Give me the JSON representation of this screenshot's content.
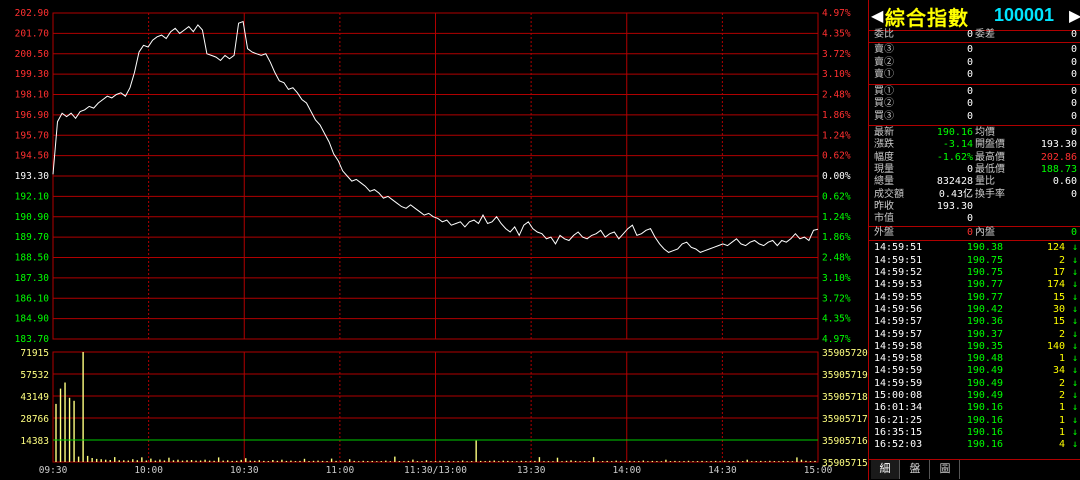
{
  "colors": {
    "up": "#ff3030",
    "down": "#00ff00",
    "neutral": "#ffffff",
    "grid": "#b00000",
    "volume": "#ffff80",
    "ref": "#00cc00"
  },
  "header": {
    "left_arrow": "◀",
    "name": "綜合指數",
    "code": "100001",
    "right_arrow": "▶"
  },
  "chart_data": [
    {
      "type": "line",
      "title": "",
      "ylim": [
        183.7,
        202.9
      ],
      "reference": 193.3,
      "x_ticks": [
        "09:30",
        "10:00",
        "10:30",
        "11:00",
        "11:30/13:00",
        "13:30",
        "14:00",
        "14:30",
        "15:00"
      ],
      "y_ticks_left": [
        "202.90",
        "201.70",
        "200.50",
        "199.30",
        "198.10",
        "196.90",
        "195.70",
        "194.50",
        "193.30",
        "192.10",
        "190.90",
        "189.70",
        "188.50",
        "187.30",
        "186.10",
        "184.90",
        "183.70"
      ],
      "y_ticks_right": [
        "4.97%",
        "4.35%",
        "3.72%",
        "3.10%",
        "2.48%",
        "1.86%",
        "1.24%",
        "0.62%",
        "0.00%",
        "0.62%",
        "1.24%",
        "1.86%",
        "2.48%",
        "3.10%",
        "3.72%",
        "4.35%",
        "4.97%"
      ],
      "series": [
        {
          "values": [
            193.4,
            196.5,
            197.0,
            196.8,
            197.0,
            196.7,
            197.1,
            197.2,
            197.4,
            197.3,
            197.6,
            197.8,
            198.0,
            197.9,
            198.1,
            198.2,
            198.0,
            198.5,
            199.4,
            200.6,
            201.0,
            200.9,
            201.3,
            201.5,
            201.6,
            201.4,
            201.8,
            202.0,
            201.7,
            201.9,
            202.1,
            201.8,
            202.2,
            201.9,
            200.5,
            200.4,
            200.3,
            200.1,
            200.4,
            200.2,
            200.4,
            202.3,
            202.4,
            200.8,
            200.6,
            200.5,
            200.4,
            200.5,
            200.0,
            199.4,
            198.9,
            198.8,
            198.4,
            198.5,
            198.2,
            197.8,
            197.6,
            197.1,
            196.6,
            196.3,
            195.8,
            195.3,
            194.6,
            194.2,
            193.6,
            193.3,
            193.0,
            193.1,
            192.9,
            192.7,
            192.4,
            192.5,
            192.3,
            192.0,
            192.1,
            191.9,
            191.7,
            191.5,
            191.4,
            191.6,
            191.4,
            191.2,
            191.0,
            191.1,
            190.9,
            190.8,
            190.6,
            190.7,
            190.4,
            190.5,
            190.6,
            190.3,
            190.6,
            190.7,
            190.5,
            191.0,
            190.5,
            190.6,
            190.9,
            190.5,
            190.2,
            190.0,
            190.3,
            189.8,
            190.4,
            190.6,
            190.2,
            190.0,
            189.9,
            189.6,
            189.7,
            189.3,
            189.8,
            189.6,
            189.5,
            189.8,
            190.0,
            189.7,
            189.6,
            189.8,
            189.9,
            190.1,
            189.7,
            189.9,
            190.0,
            189.6,
            189.9,
            190.2,
            190.4,
            189.8,
            189.9,
            190.1,
            190.2,
            189.7,
            189.3,
            189.0,
            188.8,
            188.9,
            189.0,
            189.3,
            189.4,
            189.1,
            189.0,
            188.8,
            188.9,
            189.0,
            189.1,
            189.2,
            189.3,
            189.2,
            189.4,
            189.6,
            189.3,
            189.2,
            189.4,
            189.5,
            189.3,
            189.2,
            189.4,
            189.5,
            189.2,
            189.5,
            189.4,
            189.6,
            189.9,
            189.6,
            189.7,
            189.5,
            190.1,
            190.16
          ]
        }
      ]
    },
    {
      "type": "bar",
      "title": "",
      "ylim": [
        0,
        71915
      ],
      "reference": 14383,
      "y_ticks_left": [
        "71915",
        "57532",
        "43149",
        "28766",
        "14383"
      ],
      "y_ticks_right": [
        "35905720",
        "35905719",
        "35905718",
        "35905717",
        "35905716",
        "35905715"
      ],
      "values": [
        38000,
        48000,
        52000,
        42000,
        40000,
        3500,
        71915,
        4000,
        2600,
        2000,
        1800,
        1500,
        1300,
        3200,
        1200,
        1100,
        1000,
        1800,
        1200,
        3100,
        1000,
        2200,
        900,
        1600,
        1000,
        2800,
        1100,
        1500,
        900,
        1200,
        1300,
        900,
        1000,
        1500,
        900,
        800,
        3000,
        900,
        1100,
        700,
        800,
        1400,
        2500,
        900,
        800,
        1200,
        700,
        600,
        1300,
        800,
        1500,
        700,
        900,
        600,
        700,
        2100,
        600,
        800,
        900,
        700,
        600,
        2200,
        700,
        500,
        600,
        1800,
        700,
        500,
        800,
        600,
        700,
        500,
        600,
        900,
        500,
        3500,
        600,
        500,
        700,
        1600,
        600,
        500,
        1200,
        500,
        600,
        800,
        500,
        700,
        500,
        600,
        1000,
        500,
        600,
        14000,
        700,
        600,
        800,
        1000,
        500,
        900,
        700,
        600,
        500,
        800,
        600,
        500,
        700,
        3200,
        500,
        600,
        500,
        2800,
        500,
        800,
        1100,
        700,
        500,
        600,
        500,
        3200,
        500,
        600,
        700,
        500,
        900,
        600,
        500,
        700,
        500,
        600,
        1000,
        500,
        700,
        600,
        500,
        1500,
        600,
        700,
        500,
        600,
        800,
        500,
        600,
        700,
        500,
        600,
        700,
        500,
        900,
        600,
        500,
        700,
        600,
        1500,
        500,
        600,
        700,
        500,
        800,
        600,
        500,
        700,
        600,
        500,
        3000,
        1500,
        800,
        600,
        700
      ]
    }
  ],
  "panel": {
    "rows1": [
      {
        "l": "委比",
        "v": "0",
        "l2": "委差",
        "v2": "0"
      }
    ],
    "sell": [
      {
        "l": "賣③",
        "p": "0",
        "q": "0"
      },
      {
        "l": "賣②",
        "p": "0",
        "q": "0"
      },
      {
        "l": "賣①",
        "p": "0",
        "q": "0"
      }
    ],
    "buy": [
      {
        "l": "買①",
        "p": "0",
        "q": "0"
      },
      {
        "l": "買②",
        "p": "0",
        "q": "0"
      },
      {
        "l": "買③",
        "p": "0",
        "q": "0"
      }
    ],
    "stats": [
      {
        "l": "最新",
        "v": "190.16",
        "vc": "green",
        "l2": "均價",
        "v2": "0",
        "v2c": "val"
      },
      {
        "l": "漲跌",
        "v": "-3.14",
        "vc": "green",
        "l2": "開盤價",
        "v2": "193.30",
        "v2c": "val"
      },
      {
        "l": "幅度",
        "v": "-1.62%",
        "vc": "green",
        "l2": "最高價",
        "v2": "202.86",
        "v2c": "red"
      },
      {
        "l": "現量",
        "v": "0",
        "vc": "val",
        "l2": "最低價",
        "v2": "188.73",
        "v2c": "green"
      },
      {
        "l": "總量",
        "v": "832428",
        "vc": "val",
        "l2": "量比",
        "v2": "0.60",
        "v2c": "val"
      },
      {
        "l": "成交額",
        "v": "0.43亿",
        "vc": "val",
        "l2": "換手率",
        "v2": "0",
        "v2c": "val"
      },
      {
        "l": "昨收",
        "v": "193.30",
        "vc": "val",
        "l2": "",
        "v2": "",
        "v2c": "val"
      },
      {
        "l": "市值",
        "v": "0",
        "vc": "val",
        "l2": "",
        "v2": "",
        "v2c": "val"
      }
    ],
    "outer": {
      "l": "外盤",
      "v": "0",
      "l2": "內盤",
      "v2": "0"
    },
    "ticks": [
      {
        "t": "14:59:51",
        "p": "190.38",
        "q": "124"
      },
      {
        "t": "14:59:51",
        "p": "190.75",
        "q": "2"
      },
      {
        "t": "14:59:52",
        "p": "190.75",
        "q": "17"
      },
      {
        "t": "14:59:53",
        "p": "190.77",
        "q": "174"
      },
      {
        "t": "14:59:55",
        "p": "190.77",
        "q": "15"
      },
      {
        "t": "14:59:56",
        "p": "190.42",
        "q": "30"
      },
      {
        "t": "14:59:57",
        "p": "190.36",
        "q": "15"
      },
      {
        "t": "14:59:57",
        "p": "190.37",
        "q": "2"
      },
      {
        "t": "14:59:58",
        "p": "190.35",
        "q": "140"
      },
      {
        "t": "14:59:58",
        "p": "190.48",
        "q": "1"
      },
      {
        "t": "14:59:59",
        "p": "190.49",
        "q": "34"
      },
      {
        "t": "14:59:59",
        "p": "190.49",
        "q": "2"
      },
      {
        "t": "15:00:08",
        "p": "190.49",
        "q": "2"
      },
      {
        "t": "16:01:34",
        "p": "190.16",
        "q": "1"
      },
      {
        "t": "16:21:25",
        "p": "190.16",
        "q": "1"
      },
      {
        "t": "16:35:15",
        "p": "190.16",
        "q": "1"
      },
      {
        "t": "16:52:03",
        "p": "190.16",
        "q": "4"
      }
    ],
    "tick_arrow": "↓",
    "tabs": [
      "細",
      "盤",
      "圖"
    ]
  }
}
